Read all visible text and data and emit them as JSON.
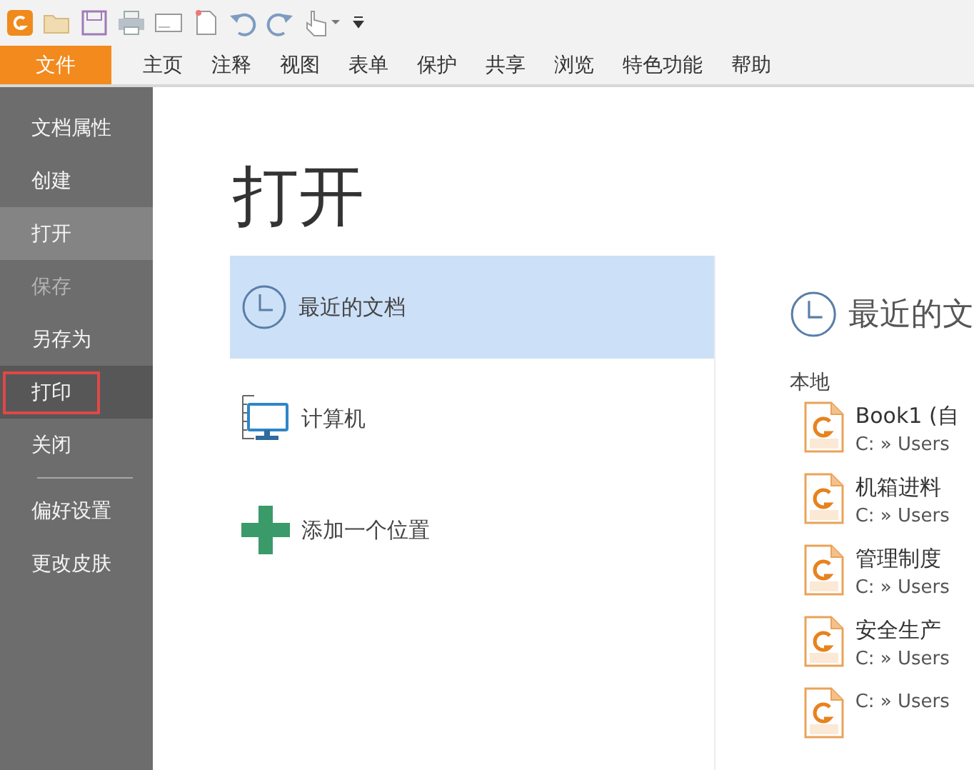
{
  "menu_tabs": [
    {
      "label": "文件",
      "selected": true
    },
    {
      "label": "主页",
      "selected": false
    },
    {
      "label": "注释",
      "selected": false
    },
    {
      "label": "视图",
      "selected": false
    },
    {
      "label": "表单",
      "selected": false
    },
    {
      "label": "保护",
      "selected": false
    },
    {
      "label": "共享",
      "selected": false
    },
    {
      "label": "浏览",
      "selected": false
    },
    {
      "label": "特色功能",
      "selected": false
    },
    {
      "label": "帮助",
      "selected": false
    }
  ],
  "sidebar": {
    "items": [
      {
        "label": "文档属性",
        "selected": false,
        "disabled": false,
        "highlighted": false
      },
      {
        "label": "创建",
        "selected": false,
        "disabled": false,
        "highlighted": false
      },
      {
        "label": "打开",
        "selected": true,
        "disabled": false,
        "highlighted": false
      },
      {
        "label": "保存",
        "selected": false,
        "disabled": true,
        "highlighted": false
      },
      {
        "label": "另存为",
        "selected": false,
        "disabled": false,
        "highlighted": false
      },
      {
        "label": "打印",
        "selected": false,
        "disabled": false,
        "highlighted": true
      },
      {
        "label": "关闭",
        "selected": false,
        "disabled": false,
        "highlighted": false
      },
      {
        "kind": "separator"
      },
      {
        "label": "偏好设置",
        "selected": false,
        "disabled": false,
        "highlighted": false
      },
      {
        "label": "更改皮肤",
        "selected": false,
        "disabled": false,
        "highlighted": false
      }
    ]
  },
  "page_title": "打开",
  "locations": [
    {
      "kind": "recent",
      "label": "最近的文档",
      "selected": true
    },
    {
      "kind": "computer",
      "label": "计算机",
      "selected": false
    },
    {
      "kind": "add",
      "label": "添加一个位置",
      "selected": false
    }
  ],
  "recent": {
    "heading": "最近的文",
    "group": "本地",
    "files": [
      {
        "name": "Book1 (自",
        "path": "C: » Users"
      },
      {
        "name": "机箱进料",
        "path": "C: » Users"
      },
      {
        "name": "管理制度",
        "path": "C: » Users"
      },
      {
        "name": "安全生产",
        "path": "C: » Users"
      },
      {
        "path": "C: » Users"
      }
    ]
  }
}
